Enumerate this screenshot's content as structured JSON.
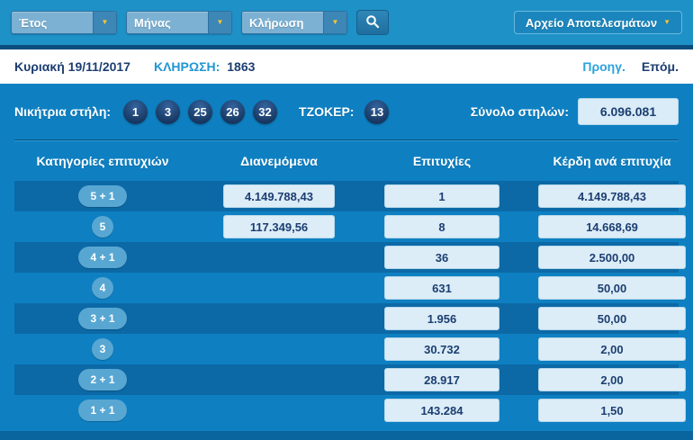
{
  "colors": {
    "panel_blue": "#0e80c2",
    "stripe_blue": "#0c69a6",
    "topbar_blue": "#1e91c7",
    "navy_text": "#1c3e70",
    "accent_yellow": "#f6c62f",
    "box_bg": "#dcedf8"
  },
  "toolbar": {
    "filters": [
      {
        "label": "Έτος"
      },
      {
        "label": "Μήνας"
      },
      {
        "label": "Κλήρωση"
      }
    ],
    "archive_button": "Αρχείο Αποτελεσμάτων"
  },
  "drawbar": {
    "date": "Κυριακή 19/11/2017",
    "draw_label": "ΚΛΗΡΩΣΗ:",
    "draw_number": "1863",
    "prev": "Προηγ.",
    "next": "Επόμ."
  },
  "results": {
    "winning_label": "Νικήτρια στήλη:",
    "numbers": [
      "1",
      "3",
      "25",
      "26",
      "32"
    ],
    "joker_label": "ΤΖΟΚΕΡ:",
    "joker": "13",
    "total_label": "Σύνολο στηλών:",
    "total_value": "6.096.081"
  },
  "table": {
    "headers": [
      "Κατηγορίες επιτυχιών",
      "Διανεμόμενα",
      "Επιτυχίες",
      "Κέρδη ανά επιτυχία"
    ],
    "rows": [
      {
        "category": "5 + 1",
        "distributed": "4.149.788,43",
        "winners": "1",
        "payout": "4.149.788,43"
      },
      {
        "category": "5",
        "distributed": "117.349,56",
        "winners": "8",
        "payout": "14.668,69"
      },
      {
        "category": "4 + 1",
        "distributed": "",
        "winners": "36",
        "payout": "2.500,00"
      },
      {
        "category": "4",
        "distributed": "",
        "winners": "631",
        "payout": "50,00"
      },
      {
        "category": "3 + 1",
        "distributed": "",
        "winners": "1.956",
        "payout": "50,00"
      },
      {
        "category": "3",
        "distributed": "",
        "winners": "30.732",
        "payout": "2,00"
      },
      {
        "category": "2 + 1",
        "distributed": "",
        "winners": "28.917",
        "payout": "2,00"
      },
      {
        "category": "1 + 1",
        "distributed": "",
        "winners": "143.284",
        "payout": "1,50"
      }
    ]
  }
}
